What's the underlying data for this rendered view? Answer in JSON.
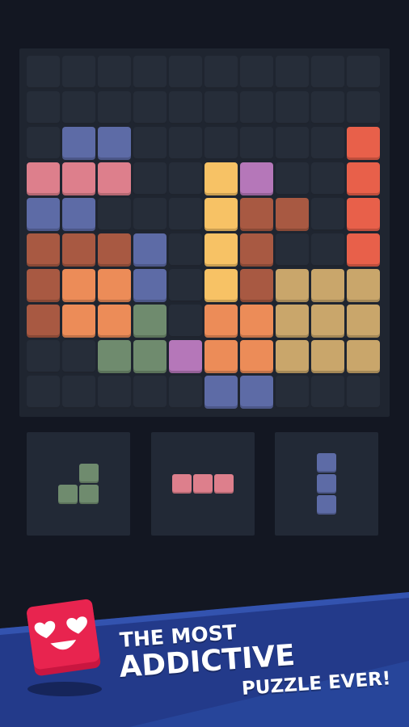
{
  "colors": {
    "E": "#262d39",
    "B": "#5d6ba6",
    "P": "#dd7f8c",
    "Y": "#f7c265",
    "V": "#b577b9",
    "R": "#e8604a",
    "K": "#a85942",
    "O": "#ec8c58",
    "G": "#6f8b6e",
    "T": "#c9a66b"
  },
  "board": {
    "rows": [
      "..........",
      "..........",
      ".BB......R",
      "PPP..YV..R",
      "BB...YKK.R",
      "KKKB.YK..R",
      "KOOB.YKTTT",
      "KOOG.OOTTT",
      "..GGVOOTTT",
      ".....BB..."
    ]
  },
  "tray": [
    {
      "name": "l-piece",
      "color": "G",
      "cells": [
        [
          1,
          0
        ],
        [
          0,
          1
        ],
        [
          1,
          1
        ]
      ]
    },
    {
      "name": "bar-horizontal",
      "color": "P",
      "cells": [
        [
          0,
          0
        ],
        [
          1,
          0
        ],
        [
          2,
          0
        ]
      ]
    },
    {
      "name": "bar-vertical",
      "color": "B",
      "cells": [
        [
          0,
          0
        ],
        [
          0,
          1
        ],
        [
          0,
          2
        ]
      ]
    }
  ],
  "banner": {
    "line1": "THE MOST",
    "line2": "ADDICTIVE",
    "line3": "PUZZLE EVER!"
  },
  "mascot": {
    "icon": "heart-eyes-cube-icon",
    "color": "#e8244f"
  },
  "banner_colors": {
    "dark": "#233a8a",
    "light": "#2e56b8"
  }
}
